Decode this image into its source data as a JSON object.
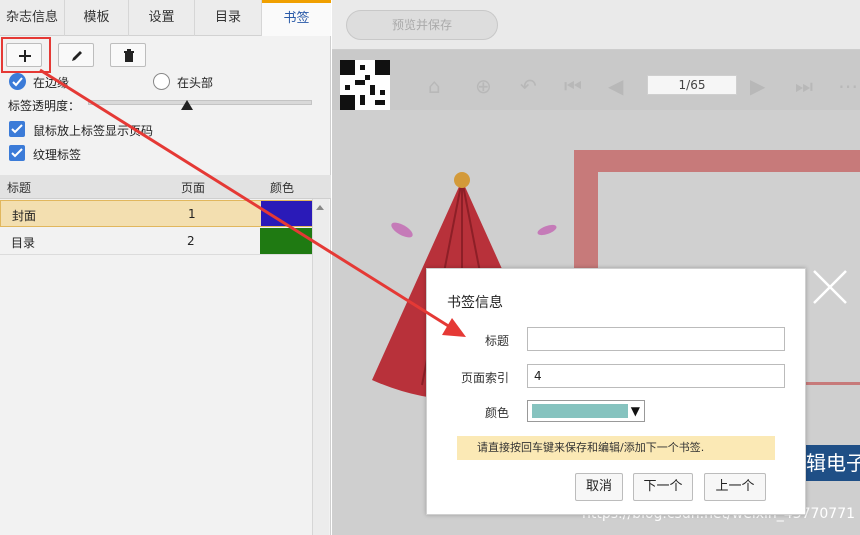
{
  "tabs": [
    {
      "label": "杂志信息"
    },
    {
      "label": "模板"
    },
    {
      "label": "设置"
    },
    {
      "label": "目录"
    },
    {
      "label": "书签"
    }
  ],
  "toolbar": {
    "add_icon": "plus-icon",
    "edit_icon": "pencil-icon",
    "delete_icon": "trash-icon"
  },
  "position": {
    "edge_label": "在边缘",
    "top_label": "在头部",
    "selected": "edge"
  },
  "transparency": {
    "label": "标签透明度：",
    "value_fraction": 0.44
  },
  "options": {
    "hover_show_page": {
      "label": "鼠标放上标签显示页码",
      "checked": true
    },
    "texture_tag": {
      "label": "纹理标签",
      "checked": true
    }
  },
  "table": {
    "headers": {
      "title": "标题",
      "page": "页面",
      "color": "颜色"
    },
    "rows": [
      {
        "title": "封面",
        "page": "1",
        "color": "#2a1ab8",
        "selected": true
      },
      {
        "title": "目录",
        "page": "2",
        "color": "#1f7a12",
        "selected": false
      }
    ]
  },
  "preview": {
    "button_label": "预览并保存"
  },
  "viewer": {
    "page_indicator": "1/65",
    "banner_text": "辑电子"
  },
  "dialog": {
    "title": "书签信息",
    "title_label": "标题",
    "title_value": "",
    "page_index_label": "页面索引",
    "page_index_value": "4",
    "color_label": "颜色",
    "color_value": "#86c3bf",
    "hint": "请直接按回车键来保存和编辑/添加下一个书签.",
    "cancel": "取消",
    "next": "下一个",
    "prev": "上一个"
  },
  "watermark": "https://blog.csdn.net/weixin_43770771",
  "colors": {
    "accent": "#3b7bd8",
    "highlight": "#e53935",
    "tab_active_border": "#f0a000"
  }
}
